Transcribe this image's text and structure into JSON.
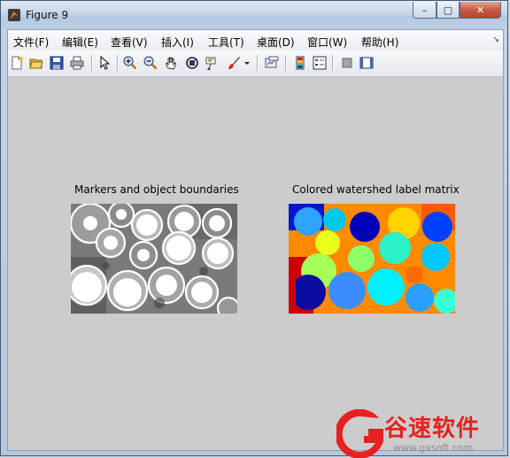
{
  "window": {
    "title": "Figure 9",
    "minimize_label": "–",
    "maximize_label": "▢",
    "close_label": "✕"
  },
  "menu": {
    "items": [
      "文件(F)",
      "编辑(E)",
      "查看(V)",
      "插入(I)",
      "工具(T)",
      "桌面(D)",
      "窗口(W)",
      "帮助(H)"
    ],
    "overflow_label": "↘"
  },
  "toolbar": {
    "icons": [
      "new-figure-icon",
      "open-file-icon",
      "save-icon",
      "print-icon",
      "edit-plot-icon",
      "zoom-in-icon",
      "zoom-out-icon",
      "pan-icon",
      "rotate-3d-icon",
      "data-cursor-icon",
      "brush-icon",
      "brush-dropdown-icon",
      "link-plot-icon",
      "insert-colorbar-icon",
      "insert-legend-icon",
      "hide-plot-tools-icon",
      "show-plot-tools-icon"
    ]
  },
  "plots": {
    "left_title": "Markers and object boundaries",
    "right_title": "Colored watershed label matrix"
  },
  "watermark": {
    "brand": "谷速软件",
    "url": "www.gxsoft.com",
    "accent": "#e8201f"
  }
}
